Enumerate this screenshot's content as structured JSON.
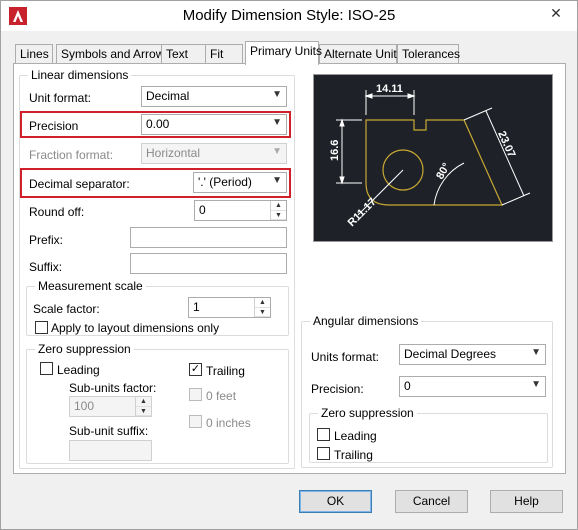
{
  "window": {
    "title": "Modify Dimension Style: ISO-25",
    "close_glyph": "✕"
  },
  "tabs": [
    {
      "label": "Lines"
    },
    {
      "label": "Symbols and Arrows"
    },
    {
      "label": "Text"
    },
    {
      "label": "Fit"
    },
    {
      "label": "Primary Units"
    },
    {
      "label": "Alternate Units"
    },
    {
      "label": "Tolerances"
    }
  ],
  "linear": {
    "group_title": "Linear dimensions",
    "unit_format_label": "Unit format:",
    "unit_format_value": "Decimal",
    "precision_label": "Precision",
    "precision_value": "0.00",
    "fraction_format_label": "Fraction format:",
    "fraction_format_value": "Horizontal",
    "decimal_separator_label": "Decimal separator:",
    "decimal_separator_value": "'.' (Period)",
    "round_off_label": "Round off:",
    "round_off_value": "0",
    "prefix_label": "Prefix:",
    "prefix_value": "",
    "suffix_label": "Suffix:",
    "suffix_value": ""
  },
  "measurement": {
    "group_title": "Measurement scale",
    "scale_factor_label": "Scale factor:",
    "scale_factor_value": "1",
    "apply_layout_label": "Apply to layout dimensions only",
    "apply_layout_checked": false
  },
  "zero_left": {
    "group_title": "Zero suppression",
    "leading_label": "Leading",
    "leading_checked": false,
    "trailing_label": "Trailing",
    "trailing_checked": true,
    "sub_units_factor_label": "Sub-units factor:",
    "sub_units_factor_value": "100",
    "sub_unit_suffix_label": "Sub-unit suffix:",
    "sub_unit_suffix_value": "",
    "feet_label": "0 feet",
    "inches_label": "0 inches"
  },
  "preview": {
    "dim_top": "14.11",
    "dim_left": "16.6",
    "dim_right": "23.07",
    "dim_angle": "80°",
    "dim_radius": "R11.17",
    "line_color": "#c8a832",
    "dim_color": "#ffffff"
  },
  "angular": {
    "group_title": "Angular dimensions",
    "units_format_label": "Units format:",
    "units_format_value": "Decimal Degrees",
    "precision_label": "Precision:",
    "precision_value": "0",
    "zero_title": "Zero suppression",
    "leading_label": "Leading",
    "leading_checked": false,
    "trailing_label": "Trailing",
    "trailing_checked": false
  },
  "buttons": {
    "ok": "OK",
    "cancel": "Cancel",
    "help": "Help"
  },
  "check_glyph": "✓",
  "arrow_glyph": "▼",
  "spin_up": "▲",
  "spin_down": "▼"
}
